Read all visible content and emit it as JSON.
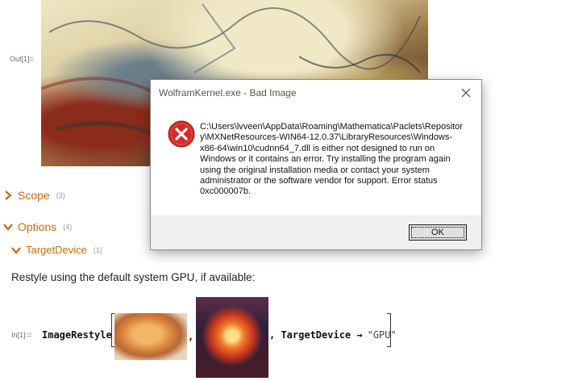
{
  "out_cell": {
    "label": "Out[1]="
  },
  "sections": {
    "scope": {
      "label": "Scope",
      "count": "(3)"
    },
    "options": {
      "label": "Options",
      "count": "(4)"
    },
    "target_device": {
      "label": "TargetDevice",
      "count": "(1)"
    }
  },
  "body_text": "Restyle using the default system GPU, if available:",
  "in_cell": {
    "label": "In[1]:=",
    "function": "ImageRestyle",
    "comma": ",",
    "option": ", TargetDevice →",
    "value": "\"GPU\""
  },
  "dialog": {
    "title": "WolframKernel.exe - Bad Image",
    "message": "C:\\Users\\lvveen\\AppData\\Roaming\\Mathematica\\Paclets\\Repository\\MXNetResources-WIN64-12.0.37\\LibraryResources\\Windows-x86-64\\win10\\cudnn64_7.dll is either not designed to run on Windows or it contains an error. Try installing the program again using the original installation media or contact your system administrator or the software vendor for support. Error status 0xc000007b.",
    "ok_label": "OK"
  },
  "colors": {
    "section": "#c46a12",
    "error_red": "#d42a2a"
  }
}
